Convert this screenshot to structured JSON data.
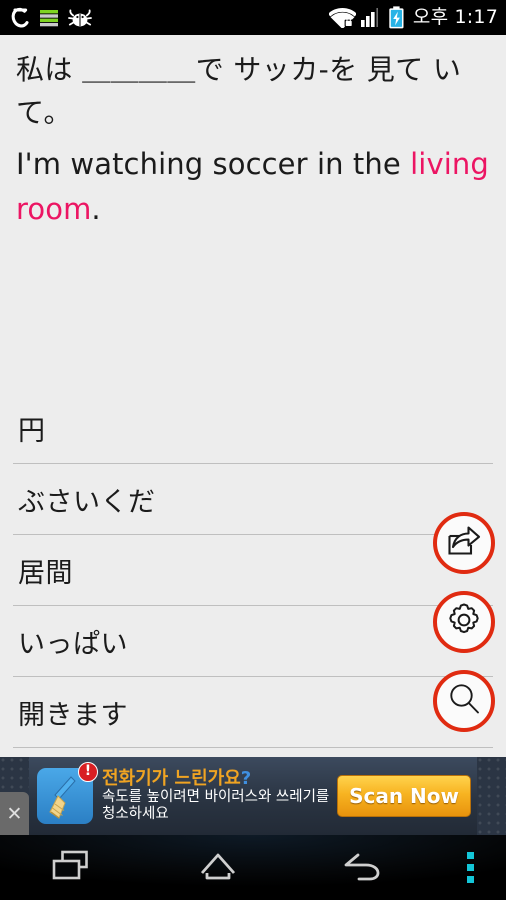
{
  "status_bar": {
    "icons_left": [
      "sigma-app-icon",
      "green-bars-icon",
      "bug-icon"
    ],
    "icons_right": [
      "wifi-secure-icon",
      "signal-bars-icon",
      "battery-charging-icon"
    ],
    "clock": "오후 1:17"
  },
  "question": {
    "japanese": "私は ＿＿＿＿で サッカ-を 見て い",
    "japanese_line2": "て。",
    "english_prefix": "I'm watching soccer in the",
    "english_highlight": "living room",
    "english_suffix": ".",
    "highlight_color": "#EC1563"
  },
  "options": [
    {
      "label": "円"
    },
    {
      "label": "ぶさいくだ"
    },
    {
      "label": "居間"
    },
    {
      "label": "いっぱい"
    },
    {
      "label": "開きます"
    }
  ],
  "fabs": [
    {
      "name": "share",
      "icon": "share-icon"
    },
    {
      "name": "settings",
      "icon": "gear-icon"
    },
    {
      "name": "search",
      "icon": "search-icon"
    }
  ],
  "fab_color": "#E02B11",
  "ad": {
    "close_label": "✕",
    "icon": "broom-cleaner-icon",
    "badge": "!",
    "title": "전화기가 느린가요",
    "title_mark": "?",
    "subtitle": "속도를 높이려면 바이러스와 쓰레기를 청소하세요",
    "cta": "Scan Now"
  },
  "navbar": {
    "buttons": [
      {
        "name": "recents",
        "icon": "recents-icon"
      },
      {
        "name": "home",
        "icon": "home-icon"
      },
      {
        "name": "back",
        "icon": "back-icon"
      },
      {
        "name": "menu",
        "icon": "overflow-menu-icon"
      }
    ]
  }
}
